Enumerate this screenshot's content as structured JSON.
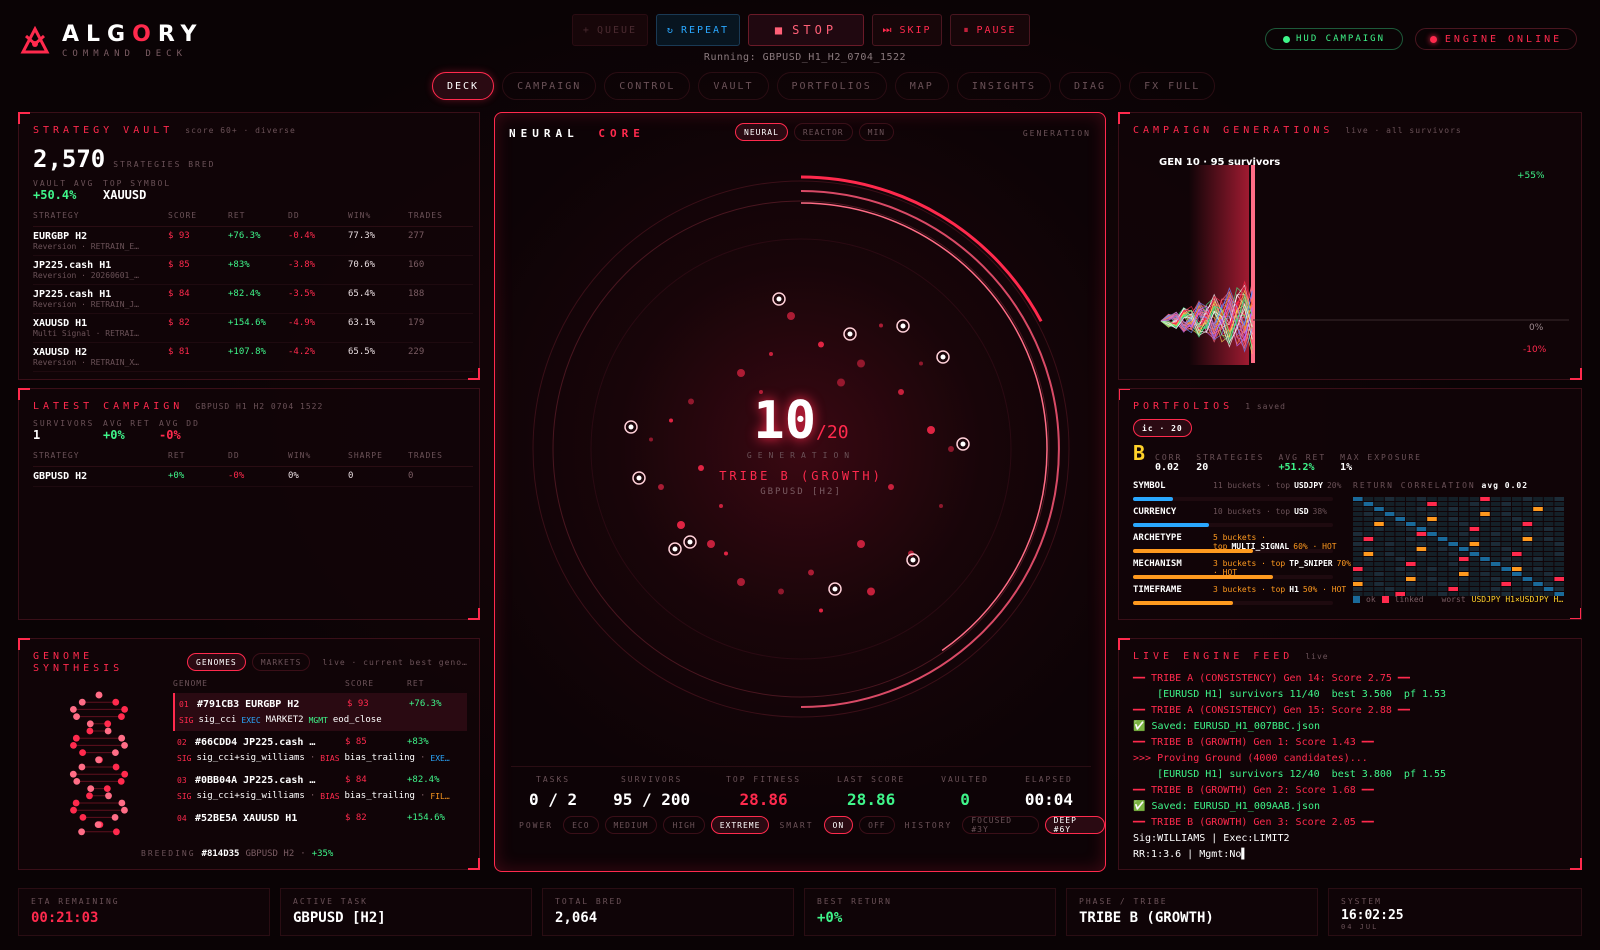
{
  "brand": {
    "name": "ALGORY",
    "sub": "COMMAND DECK"
  },
  "controls": {
    "queue": "QUEUE",
    "repeat": "REPEAT",
    "stop": "STOP",
    "skip": "SKIP",
    "pause": "PAUSE",
    "running": "Running: GBPUSD_H1_H2_0704_1522"
  },
  "status": {
    "hud": "HUD CAMPAIGN",
    "engine": "ENGINE ONLINE"
  },
  "nav": [
    "DECK",
    "CAMPAIGN",
    "CONTROL",
    "VAULT",
    "PORTFOLIOS",
    "MAP",
    "INSIGHTS",
    "DIAG",
    "FX FULL"
  ],
  "vault": {
    "title": "STRATEGY VAULT",
    "sub": "score 60+ · diverse",
    "count": "2,570",
    "count_label": "STRATEGIES BRED",
    "avg_label": "VAULT AVG",
    "avg": "+50.4%",
    "top_label": "TOP SYMBOL",
    "top": "XAUUSD",
    "headers": [
      "STRATEGY",
      "SCORE",
      "RET",
      "DD",
      "WIN%",
      "TRADES"
    ],
    "rows": [
      {
        "sym": "EURGBP H2",
        "arch": "Reversion · RETRAIN_E…",
        "score": "93",
        "ret": "+76.3%",
        "dd": "-0.4%",
        "win": "77.3%",
        "trades": "277"
      },
      {
        "sym": "JP225.cash H1",
        "arch": "Reversion · 20260601_…",
        "score": "85",
        "ret": "+83%",
        "dd": "-3.8%",
        "win": "70.6%",
        "trades": "160"
      },
      {
        "sym": "JP225.cash H1",
        "arch": "Reversion · RETRAIN_J…",
        "score": "84",
        "ret": "+82.4%",
        "dd": "-3.5%",
        "win": "65.4%",
        "trades": "188"
      },
      {
        "sym": "XAUUSD H1",
        "arch": "Multi Signal · RETRAI…",
        "score": "82",
        "ret": "+154.6%",
        "dd": "-4.9%",
        "win": "63.1%",
        "trades": "179"
      },
      {
        "sym": "XAUUSD H2",
        "arch": "Reversion · RETRAIN_X…",
        "score": "81",
        "ret": "+107.8%",
        "dd": "-4.2%",
        "win": "65.5%",
        "trades": "229"
      }
    ]
  },
  "latest": {
    "title": "LATEST CAMPAIGN",
    "sub": "GBPUSD H1 H2 0704 1522",
    "surv_label": "SURVIVORS",
    "surv": "1",
    "ret_label": "AVG RET",
    "ret": "+0%",
    "dd_label": "AVG DD",
    "dd": "-0%",
    "headers": [
      "STRATEGY",
      "RET",
      "DD",
      "WIN%",
      "SHARPE",
      "TRADES"
    ],
    "row": {
      "sym": "GBPUSD H2",
      "ret": "+0%",
      "dd": "-0%",
      "win": "0%",
      "sharpe": "0",
      "trades": "0"
    }
  },
  "genome": {
    "title1": "GENOME",
    "title2": "SYNTHESIS",
    "tab1": "GENOMES",
    "tab2": "MARKETS",
    "sub": "live · current best geno…",
    "headers": [
      "GENOME",
      "SCORE",
      "RET"
    ],
    "rows": [
      {
        "n": "01",
        "id": "#791CB3 EURGBP H2",
        "score": "93",
        "ret": "+76.3%",
        "sig": "sig_cci",
        "k2": "EXEC",
        "v2": "MARKET2",
        "k3": "MGMT",
        "v3": "eod_close"
      },
      {
        "n": "02",
        "id": "#66CDD4 JP225.cash …",
        "score": "85",
        "ret": "+83%",
        "sig": "sig_cci+sig_williams",
        "k2": "BIAS",
        "v2": "bias_trailing",
        "k3": "EXE…",
        "v3": ""
      },
      {
        "n": "03",
        "id": "#0BB04A JP225.cash …",
        "score": "84",
        "ret": "+82.4%",
        "sig": "sig_cci+sig_williams",
        "k2": "BIAS",
        "v2": "bias_trailing",
        "k3": "FIL…",
        "v3": ""
      },
      {
        "n": "04",
        "id": "#52BE5A XAUUSD H1",
        "score": "82",
        "ret": "+154.6%"
      }
    ],
    "breeding_label": "BREEDING",
    "breeding_id": "#814D35",
    "breeding_sym": "GBPUSD H2",
    "breeding_pct": "+35%"
  },
  "core": {
    "title1": "NEURAL",
    "title2": "CORE",
    "modes": [
      "NEURAL",
      "REACTOR",
      "MIN"
    ],
    "gen_label": "GENERATION",
    "gen": "10",
    "gen_total": "/20",
    "tribe": "TRIBE B (GROWTH)",
    "sym": "GBPUSD [H2]",
    "stats": [
      {
        "l": "TASKS",
        "v": "0 / 2"
      },
      {
        "l": "SURVIVORS",
        "v": "95 / 200"
      },
      {
        "l": "TOP FITNESS",
        "v": "28.86"
      },
      {
        "l": "LAST SCORE",
        "v": "28.86"
      },
      {
        "l": "VAULTED",
        "v": "0"
      },
      {
        "l": "ELAPSED",
        "v": "00:04"
      }
    ],
    "power_label": "POWER",
    "power": [
      "ECO",
      "MEDIUM",
      "HIGH",
      "EXTREME"
    ],
    "smart_label": "SMART",
    "smart": [
      "ON",
      "OFF"
    ],
    "history_label": "HISTORY",
    "history": [
      "FOCUSED #3Y",
      "DEEP #6Y"
    ]
  },
  "generations": {
    "title": "CAMPAIGN GENERATIONS",
    "sub": "live · all survivors",
    "gen_label": "GEN 10 · 95 survivors",
    "y_top": "+55%",
    "y_zero": "0%",
    "y_low": "-10%"
  },
  "portfolios": {
    "title": "PORTFOLIOS",
    "sub": "1 saved",
    "chip": "ic · 20",
    "grade": "B",
    "corr_l": "CORR",
    "corr": "0.02",
    "strat_l": "STRATEGIES",
    "strat": "20",
    "ret_l": "AVG RET",
    "ret": "+51.2%",
    "exp_l": "MAX EXPOSURE",
    "exp": "1%",
    "corr_title": "RETURN CORRELATION",
    "corr_avg": "avg 0.02",
    "ok": "ok",
    "linked": "linked",
    "worst_l": "worst",
    "worst": "USDJPY H1×USDJPY H…",
    "buckets": [
      {
        "name": "SYMBOL",
        "info": "11 buckets · top",
        "top": "USDJPY",
        "pct": "20%",
        "fill": 0.2
      },
      {
        "name": "CURRENCY",
        "info": "10 buckets · top",
        "top": "USD",
        "pct": "38%",
        "fill": 0.38
      },
      {
        "name": "ARCHETYPE",
        "info": "5 buckets · top",
        "top": "MULTI_SIGNAL",
        "pct": "60% · HOT",
        "fill": 0.6
      },
      {
        "name": "MECHANISM",
        "info": "3 buckets · top",
        "top": "TP_SNIPER",
        "pct": "70% · HOT",
        "fill": 0.7
      },
      {
        "name": "TIMEFRAME",
        "info": "3 buckets · top",
        "top": "H1",
        "pct": "50% · HOT",
        "fill": 0.5
      }
    ]
  },
  "feed": {
    "title": "LIVE ENGINE FEED",
    "sub": "live",
    "lines": [
      {
        "t": "━━ TRIBE A (CONSISTENCY) Gen 14: Score 2.75 ━━",
        "c": "red"
      },
      {
        "t": "    [EURUSD H1] survivors 11/40  best 3.500  pf 1.53",
        "c": "green"
      },
      {
        "t": "━━ TRIBE A (CONSISTENCY) Gen 15: Score 2.88 ━━",
        "c": "red"
      },
      {
        "t": "✅ Saved: EURUSD_H1_007BBC.json",
        "c": "green"
      },
      {
        "t": "━━ TRIBE B (GROWTH) Gen 1: Score 1.43 ━━",
        "c": "red"
      },
      {
        "t": ">>> Proving Ground (4000 candidates)...",
        "c": "red"
      },
      {
        "t": "    [EURUSD H1] survivors 12/40  best 3.800  pf 1.55",
        "c": "green"
      },
      {
        "t": "━━ TRIBE B (GROWTH) Gen 2: Score 1.68 ━━",
        "c": "red"
      },
      {
        "t": "✅ Saved: EURUSD_H1_009AAB.json",
        "c": "green"
      },
      {
        "t": "━━ TRIBE B (GROWTH) Gen 3: Score 2.05 ━━",
        "c": "red"
      },
      {
        "t": "Sig:WILLIAMS | Exec:LIMIT2",
        "c": "white"
      },
      {
        "t": "RR:1:3.6 | Mgmt:No▌",
        "c": "white"
      }
    ]
  },
  "bottom": [
    {
      "l": "ETA REMAINING",
      "v": "00:21:03",
      "c": "red"
    },
    {
      "l": "ACTIVE TASK",
      "v": "GBPUSD [H2]",
      "c": "white"
    },
    {
      "l": "TOTAL BRED",
      "v": "2,064",
      "c": "white"
    },
    {
      "l": "BEST RETURN",
      "v": "+0%",
      "c": "green"
    },
    {
      "l": "PHASE / TRIBE",
      "v": "TRIBE B (GROWTH)",
      "c": "white"
    },
    {
      "l": "SYSTEM",
      "v": "16:02:25",
      "c": "white",
      "s": "04 JUL"
    }
  ],
  "colors": {
    "accent": "#ff2a4d",
    "green": "#3ff58a",
    "blue": "#2aa8ff",
    "orange": "#ff9a1f"
  }
}
